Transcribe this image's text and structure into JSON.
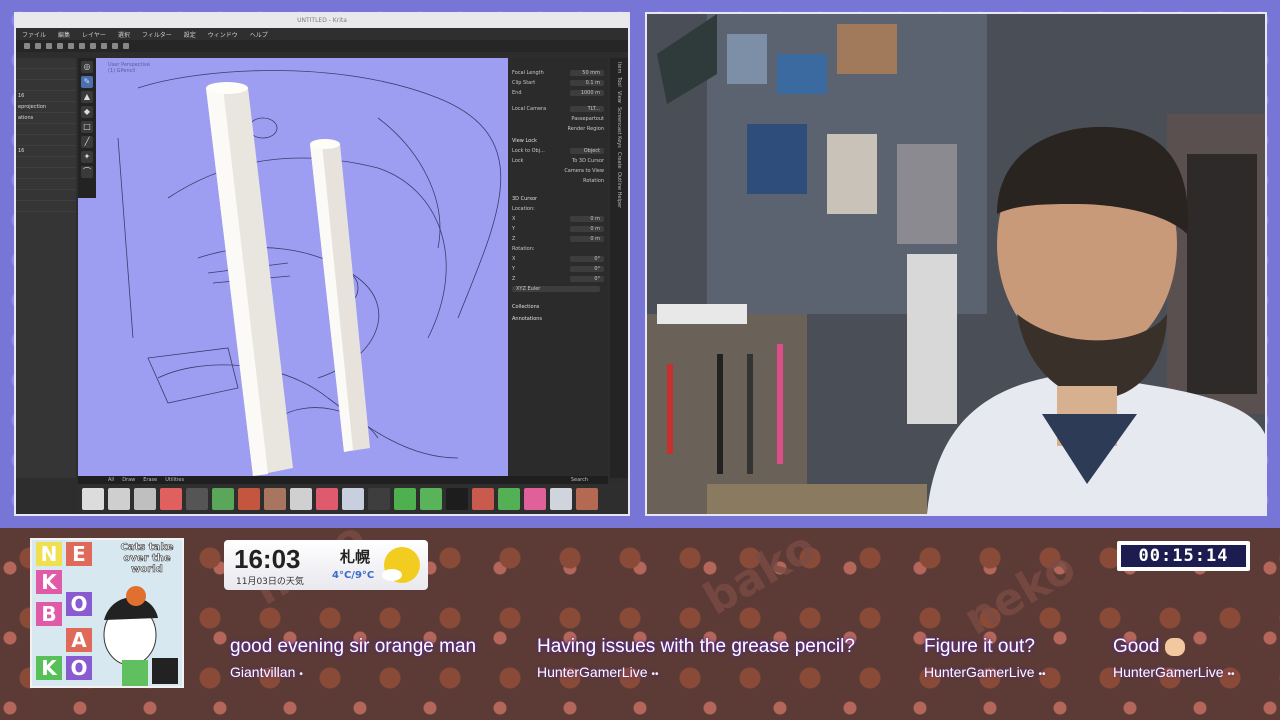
{
  "app": {
    "title": "UNTITLED - Krita",
    "menu": [
      "ファイル",
      "編集",
      "レイヤー",
      "選択",
      "フィルター",
      "設定",
      "ウィンドウ",
      "ヘルプ"
    ],
    "left_panel": [
      "16",
      "eprojection",
      "ations",
      "16"
    ],
    "viewport_info": [
      "User Perspective",
      "(1) GPencil"
    ],
    "properties": {
      "focal_length_label": "Focal Length",
      "focal_length": "50 mm",
      "clip_start_label": "Clip Start",
      "clip_start": "0.1 m",
      "end_label": "End",
      "end": "1000 m",
      "local_camera_label": "Local Camera",
      "local_camera_value": "TLT...",
      "passepartout": "Passepartout",
      "render_region": "Render Region",
      "view_lock": "View Lock",
      "lock_to_object_label": "Lock to Obj...",
      "lock_to_object_value": "Object",
      "lock_label": "Lock",
      "to_3d_cursor": "To 3D Cursor",
      "camera_to_view": "Camera to View",
      "rotation_lock": "Rotation",
      "cursor_3d": "3D Cursor",
      "location": "Location:",
      "loc_x": "0 m",
      "loc_y": "0 m",
      "loc_z": "0 m",
      "rotation": "Rotation:",
      "rot_x": "0°",
      "rot_y": "0°",
      "rot_z": "0°",
      "rotation_mode": "XYZ Euler",
      "collections": "Collections",
      "annotations": "Annotations"
    },
    "side_tabs": [
      "Item",
      "Tool",
      "View",
      "Screencast Keys",
      "Create",
      "Outline Helper"
    ],
    "asset_tabs": [
      "All",
      "Draw",
      "Erase",
      "Utilities"
    ],
    "asset_search": "Search"
  },
  "overlay": {
    "cover_title": "Cats take over the world",
    "cover_letters": [
      "N",
      "E",
      "K",
      "O",
      "B",
      "A",
      "K",
      "O"
    ],
    "clock": {
      "time": "16:03",
      "date": "11月03日の天気",
      "city": "札幌",
      "temp": "4°C/9°C"
    },
    "timer": "00:15:14",
    "chat": [
      {
        "text": "good evening sir orange man",
        "user": "Giantvillan"
      },
      {
        "text": "Having issues with the grease pencil?",
        "user": "HunterGamerLive"
      },
      {
        "text": "Figure it out?",
        "user": "HunterGamerLive"
      },
      {
        "text": "Good",
        "user": "HunterGamerLive"
      }
    ]
  }
}
